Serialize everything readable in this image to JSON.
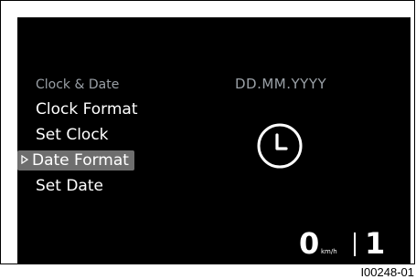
{
  "menu": {
    "header": "Clock & Date",
    "items": [
      {
        "label": "Clock Format",
        "selected": false
      },
      {
        "label": "Set Clock",
        "selected": false
      },
      {
        "label": "Date Format",
        "selected": true
      },
      {
        "label": "Set Date",
        "selected": false
      }
    ],
    "selection_icon": "chevron-right-outline-icon"
  },
  "preview": {
    "format": "DD.MM.YYYY",
    "icon": "clock-icon"
  },
  "status": {
    "speed": "0",
    "speed_unit": "km/h",
    "gear": "1"
  },
  "figure_id": "I00248-01",
  "colors": {
    "screen_bg": "#000000",
    "text": "#ffffff",
    "muted_text": "#9aa0a6",
    "selection_bg": "#6e6e6e"
  }
}
